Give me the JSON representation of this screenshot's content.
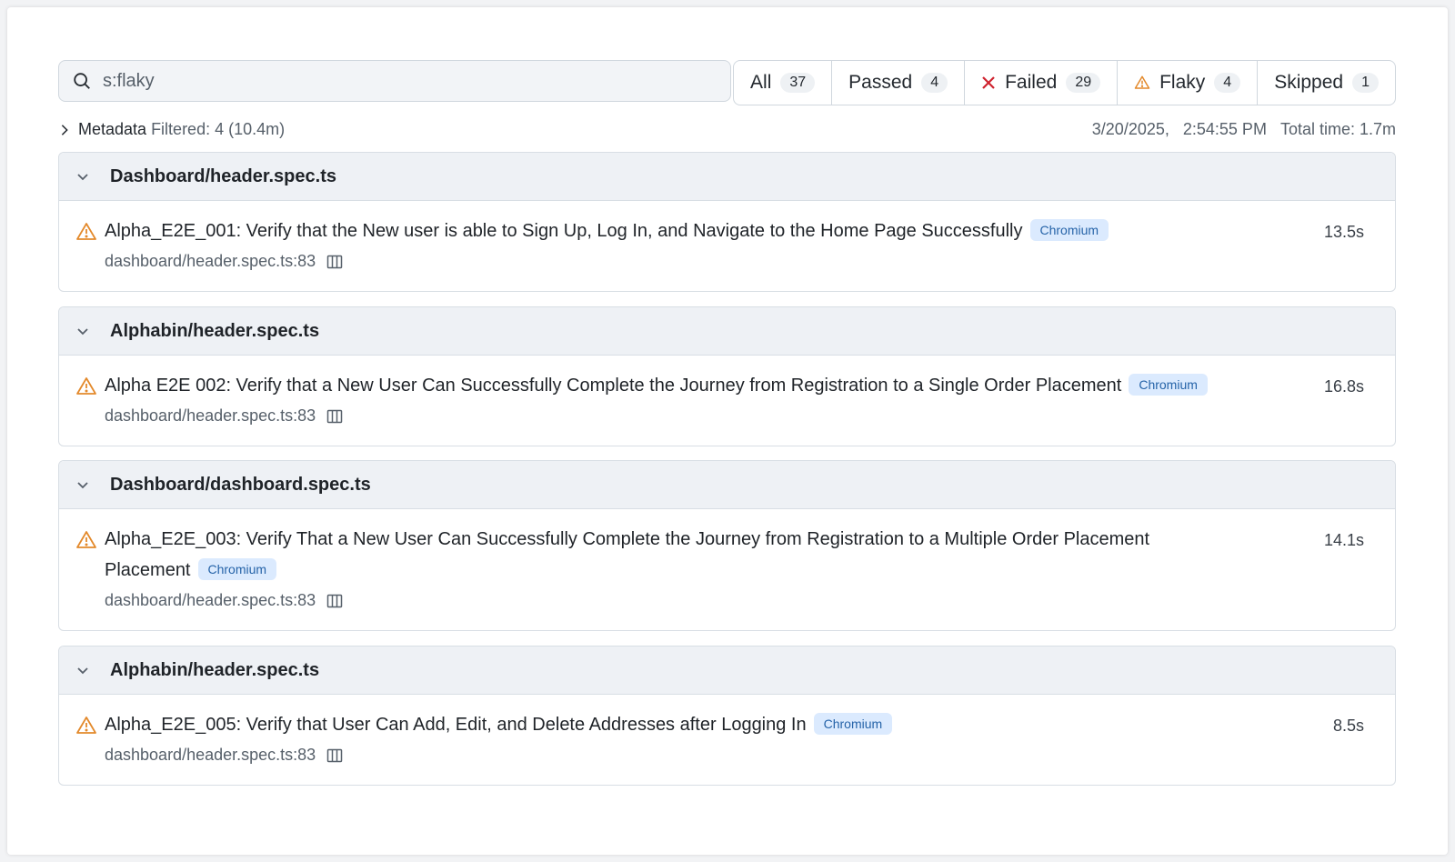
{
  "search": {
    "value": "s:flaky",
    "placeholder": ""
  },
  "filters": [
    {
      "label": "All",
      "count": "37"
    },
    {
      "label": "Passed",
      "count": "4"
    },
    {
      "label": "Failed",
      "count": "29",
      "icon": "x-icon",
      "color": "#cf222e"
    },
    {
      "label": "Flaky",
      "count": "4",
      "icon": "warning-icon",
      "color": "#e3892b"
    },
    {
      "label": "Skipped",
      "count": "1"
    }
  ],
  "metadata": {
    "label": "Metadata",
    "filtered": "Filtered: 4 (10.4m)"
  },
  "run": {
    "date": "3/20/2025,",
    "time": "2:54:55 PM",
    "total": "Total time: 1.7m"
  },
  "groups": [
    {
      "file": "Dashboard/header.spec.ts",
      "test": {
        "title": "Alpha_E2E_001: Verify that the New user is able to Sign Up, Log In, and Navigate to the Home Page Successfully",
        "tag": "Chromium",
        "duration": "13.5s",
        "location": "dashboard/header.spec.ts:83"
      }
    },
    {
      "file": "Alphabin/header.spec.ts",
      "test": {
        "title": "Alpha E2E 002: Verify that a New User Can Successfully Complete the Journey from Registration to a Single Order Placement",
        "tag": "Chromium",
        "duration": "16.8s",
        "location": "dashboard/header.spec.ts:83"
      }
    },
    {
      "file": "Dashboard/dashboard.spec.ts",
      "test": {
        "title": "Alpha_E2E_003: Verify That a New User Can Successfully Complete the Journey from Registration to a Multiple Order Placement Placement",
        "tag": "Chromium",
        "duration": "14.1s",
        "location": "dashboard/header.spec.ts:83"
      }
    },
    {
      "file": "Alphabin/header.spec.ts",
      "test": {
        "title": "Alpha_E2E_005: Verify that User Can Add, Edit, and Delete Addresses after Logging In",
        "tag": "Chromium",
        "duration": "8.5s",
        "location": "dashboard/header.spec.ts:83"
      }
    }
  ],
  "colors": {
    "warning": "#e3892b",
    "tag_bg": "#dbeafe",
    "tag_fg": "#2563a8",
    "failed": "#cf222e"
  }
}
